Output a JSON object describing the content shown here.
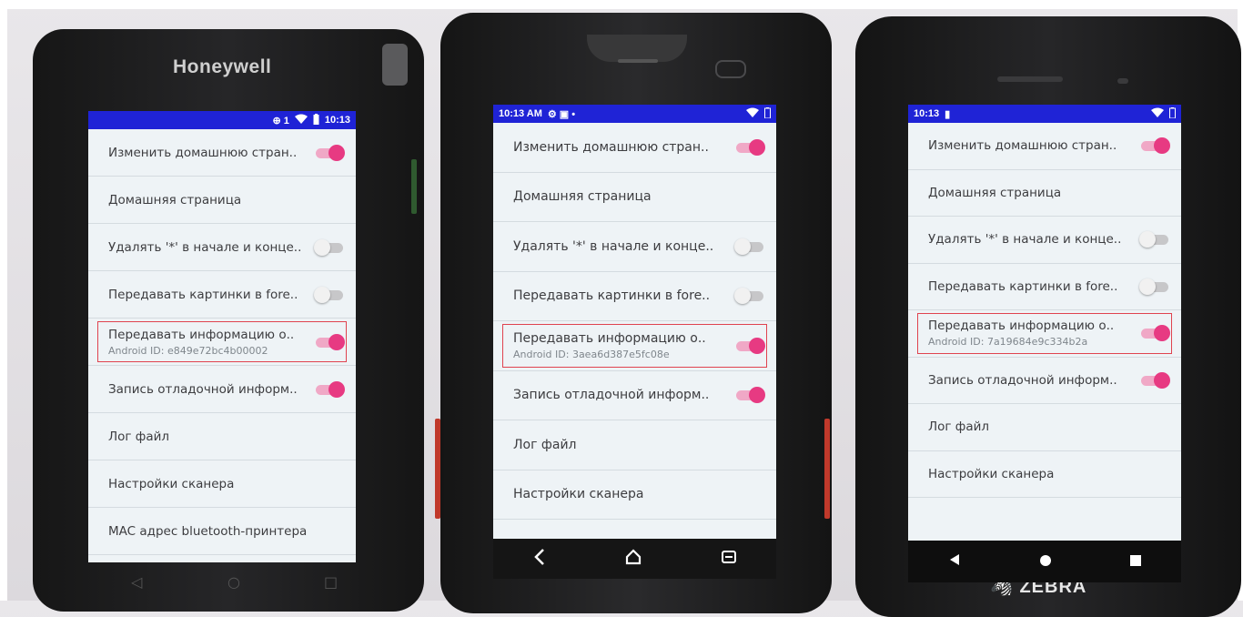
{
  "brands": {
    "left": "Honeywell",
    "right": "ZEBRA"
  },
  "phones": [
    {
      "status": {
        "time": "10:13",
        "glyphs": "⊕ 1"
      },
      "rows": [
        {
          "title": "Изменить домашнюю стран..",
          "toggle": "on"
        },
        {
          "title": "Домашняя страница"
        },
        {
          "title": "Удалять '*' в начале и конце..",
          "toggle": "off"
        },
        {
          "title": "Передавать картинки в fore..",
          "toggle": "off"
        },
        {
          "title": "Передавать информацию о..",
          "subtitle": "Android ID: e849e72bc4b00002",
          "toggle": "on",
          "highlighted": true
        },
        {
          "title": "Запись отладочной информ..",
          "toggle": "on"
        },
        {
          "title": "Лог файл"
        },
        {
          "title": "Настройки сканера"
        },
        {
          "title": "MAC адрес bluetooth-принтера"
        }
      ]
    },
    {
      "status": {
        "time": "10:13 AM",
        "glyphs": "⚙ ▣ •"
      },
      "rows": [
        {
          "title": "Изменить домашнюю стран..",
          "toggle": "on"
        },
        {
          "title": "Домашняя страница"
        },
        {
          "title": "Удалять '*' в начале и конце..",
          "toggle": "off"
        },
        {
          "title": "Передавать картинки в fore..",
          "toggle": "off"
        },
        {
          "title": "Передавать информацию о..",
          "subtitle": "Android ID: 3aea6d387e5fc08e",
          "toggle": "on",
          "highlighted": true
        },
        {
          "title": "Запись отладочной информ..",
          "toggle": "on"
        },
        {
          "title": "Лог файл"
        },
        {
          "title": "Настройки сканера"
        }
      ]
    },
    {
      "status": {
        "time": "10:13",
        "glyphs": "▮"
      },
      "rows": [
        {
          "title": "Изменить домашнюю стран..",
          "toggle": "on"
        },
        {
          "title": "Домашняя страница"
        },
        {
          "title": "Удалять '*' в начале и конце..",
          "toggle": "off"
        },
        {
          "title": "Передавать картинки в fore..",
          "toggle": "off"
        },
        {
          "title": "Передавать информацию о..",
          "subtitle": "Android ID: 7a19684e9c334b2a",
          "toggle": "on",
          "highlighted": true
        },
        {
          "title": "Запись отладочной информ..",
          "toggle": "on"
        },
        {
          "title": "Лог файл"
        },
        {
          "title": "Настройки сканера"
        }
      ]
    }
  ],
  "colors": {
    "statusbar": "#1f23d6",
    "toggle_on": "#e73a82",
    "highlight": "#e0434f"
  },
  "icons": {
    "back": "back-icon",
    "home": "home-icon",
    "recents": "recents-icon",
    "wifi": "wifi-icon",
    "battery": "battery-icon"
  }
}
